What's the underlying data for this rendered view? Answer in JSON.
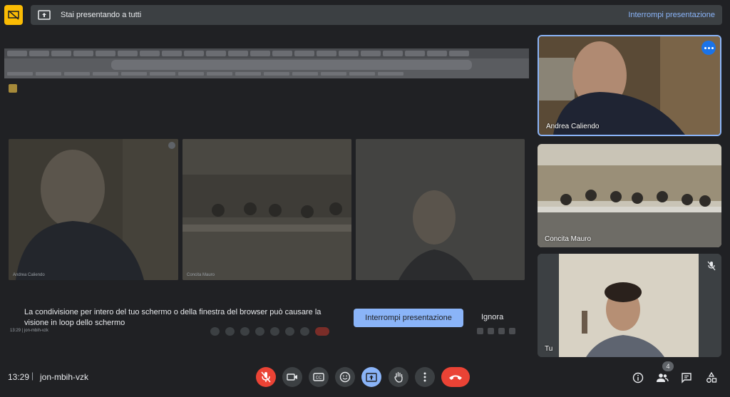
{
  "top_bar": {
    "presenting_text": "Stai presentando a tutti",
    "stop_link": "Interrompi presentazione"
  },
  "shared_screen": {
    "inner_tiles": [
      {
        "label": "Andrea Caliendo"
      },
      {
        "label": "Concita Mauro"
      },
      {
        "label": ""
      }
    ],
    "warning": {
      "text": "La condivisione per intero del tuo schermo o della finestra del browser può causare la visione in loop dello schermo",
      "stop_button": "Interrompi presentazione",
      "ignore_button": "Ignora"
    },
    "inner_meeting_info": "13:29 | jon-mbih-vzk"
  },
  "participants": [
    {
      "name": "Andrea Caliendo",
      "speaking": true,
      "bg": "#4a3d2e"
    },
    {
      "name": "Concita Mauro",
      "speaking": false,
      "bg": "#7e7a70"
    },
    {
      "name": "Tu",
      "muted": true,
      "bg": "#3c4043"
    }
  ],
  "bottom_bar": {
    "time": "13:29",
    "separator": "|",
    "meeting_code": "jon-mbih-vzk",
    "participants_count": "4"
  },
  "colors": {
    "accent": "#8ab4f8",
    "danger": "#ea4335",
    "background": "#202124",
    "surface": "#3c4043"
  }
}
